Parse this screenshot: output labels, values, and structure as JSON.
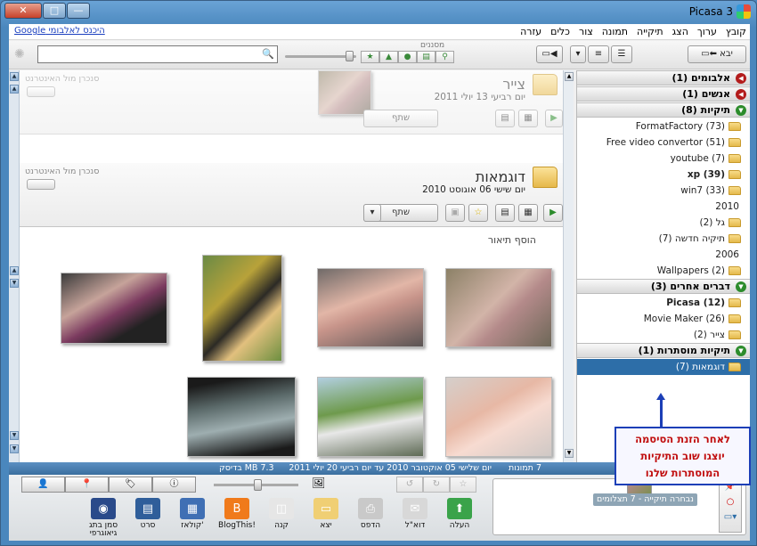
{
  "window": {
    "title": "Picasa 3",
    "close": "✕",
    "minimize": "—",
    "maximize": "□"
  },
  "menu": [
    "קובץ",
    "ערוך",
    "הצג",
    "תיקייה",
    "תמונה",
    "צור",
    "כלים",
    "עזרה"
  ],
  "signin_link": "היכנס לאלבומי Google",
  "toolbar": {
    "import_label": "יבא",
    "search_placeholder": "",
    "filters_label": "מסננים"
  },
  "tree": {
    "albums": "אלבומים (1)",
    "people": "אנשים (1)",
    "folders": "תיקיות (8)",
    "folder_items": [
      {
        "label": "FormatFactory (73)",
        "type": "folder",
        "bold": false
      },
      {
        "label": "Free video convertor (51)",
        "type": "folder",
        "bold": false
      },
      {
        "label": "youtube (7)",
        "type": "folder",
        "bold": false
      },
      {
        "label": "xp (39)",
        "type": "folder",
        "bold": true
      },
      {
        "label": "win7 (33)",
        "type": "folder",
        "bold": false
      },
      {
        "label": "2010",
        "type": "year",
        "bold": false
      },
      {
        "label": "גל (2)",
        "type": "folder",
        "bold": false
      },
      {
        "label": "תיקיה חדשה (7)",
        "type": "folder",
        "bold": false
      },
      {
        "label": "2006",
        "type": "year",
        "bold": false
      },
      {
        "label": "Wallpapers (2)",
        "type": "folder",
        "bold": false
      }
    ],
    "other": "דברים אחרים (3)",
    "other_items": [
      {
        "label": "Picasa (12)",
        "bold": true
      },
      {
        "label": "Movie Maker (26)",
        "bold": false
      },
      {
        "label": "צייר (2)",
        "bold": false
      }
    ],
    "hidden": "תיקיות מוסתרות (1)",
    "hidden_items": [
      {
        "label": "דוגמאות (7)",
        "selected": true
      }
    ]
  },
  "albums": [
    {
      "name": "צייר",
      "date": "יום רביעי 13 יולי 2011",
      "sync": "סנכרן מול האינטרנט",
      "share": "שתף"
    },
    {
      "name": "דוגמאות",
      "date": "יום שישי 06 אוגוסט 2010",
      "sync": "סנכרן מול האינטרנט",
      "share": "שתף",
      "description": "הוסף תיאור"
    }
  ],
  "callout": [
    "לאחר הזנת הסיסמה",
    "יוצגו שוב התיקיות",
    "המוסתרות שלנו"
  ],
  "status": {
    "count": "7 תמונות",
    "range": "יום שלישי 05 אוקטובר 2010 עד יום רביעי 20 יולי 2011",
    "size": "7.3 MB בדיסק"
  },
  "tray": {
    "selection": "נבחרה תיקייה - 7 תצלומים"
  },
  "actions": [
    {
      "label": "העלה",
      "icon": "upload-icon",
      "color": "#3aa34a"
    },
    {
      "label": "דוא\"ל",
      "icon": "email-icon",
      "color": "#d8d8d8"
    },
    {
      "label": "הדפס",
      "icon": "print-icon",
      "color": "#c9c9c9"
    },
    {
      "label": "יצא",
      "icon": "export-folder-icon",
      "color": "#f0cf74"
    },
    {
      "label": "קנה",
      "icon": "shop-icon",
      "color": "#e6e6e6"
    },
    {
      "label": "BlogThis!",
      "icon": "blogger-icon",
      "color": "#f07a1b"
    },
    {
      "label": "קולאז'",
      "icon": "collage-icon",
      "color": "#3f6fb4"
    },
    {
      "label": "סרט",
      "icon": "movie-icon",
      "color": "#2f5e9a"
    },
    {
      "label": "סמן בתג גיאוגרפי",
      "icon": "geotag-icon",
      "color": "#2a4a8a"
    }
  ]
}
